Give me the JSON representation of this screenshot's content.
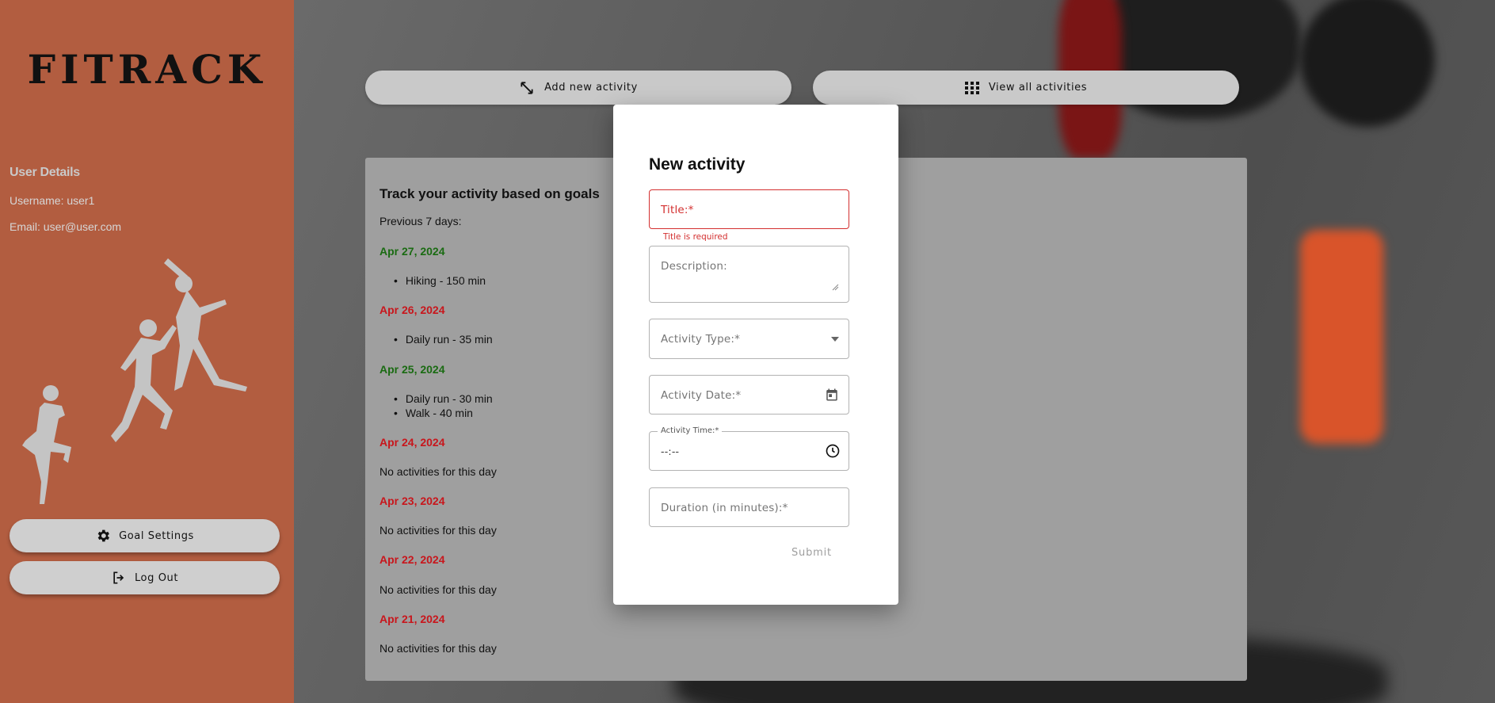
{
  "app": {
    "logo": "FITRACK"
  },
  "user": {
    "heading": "User Details",
    "username": "Username: user1",
    "email": "Email: user@user.com"
  },
  "sidebar_buttons": {
    "goal_settings": "Goal Settings",
    "log_out": "Log Out"
  },
  "top_buttons": {
    "add": "Add new activity",
    "view_all": "View all activities"
  },
  "panel": {
    "title": "Track your activity based on goals",
    "subtitle": "Previous 7 days:",
    "days": [
      {
        "date": "Apr 27, 2024",
        "status": "met",
        "items": [
          "Hiking - 150 min"
        ]
      },
      {
        "date": "Apr 26, 2024",
        "status": "missed",
        "items": [
          "Daily run - 35 min"
        ]
      },
      {
        "date": "Apr 25, 2024",
        "status": "met",
        "items": [
          "Daily run - 30 min",
          "Walk - 40 min"
        ]
      },
      {
        "date": "Apr 24, 2024",
        "status": "missed",
        "items": [],
        "empty": "No activities for this day"
      },
      {
        "date": "Apr 23, 2024",
        "status": "missed",
        "items": [],
        "empty": "No activities for this day"
      },
      {
        "date": "Apr 22, 2024",
        "status": "missed",
        "items": [],
        "empty": "No activities for this day"
      },
      {
        "date": "Apr 21, 2024",
        "status": "missed",
        "items": [],
        "empty": "No activities for this day"
      }
    ]
  },
  "modal": {
    "title": "New activity",
    "title_field": {
      "label": "Title:*",
      "error": "Title is required"
    },
    "description_field": {
      "label": "Description:"
    },
    "activity_type_field": {
      "label": "Activity Type:*"
    },
    "activity_date_field": {
      "label": "Activity Date:*"
    },
    "activity_time_field": {
      "label": "Activity Time:*",
      "value": "--:--"
    },
    "duration_field": {
      "label": "Duration (in minutes):*"
    },
    "submit": "Submit"
  },
  "colors": {
    "sidebar": "#b25d40",
    "met": "#1a6b12",
    "missed": "#c8161c",
    "error": "#d32f2f"
  }
}
